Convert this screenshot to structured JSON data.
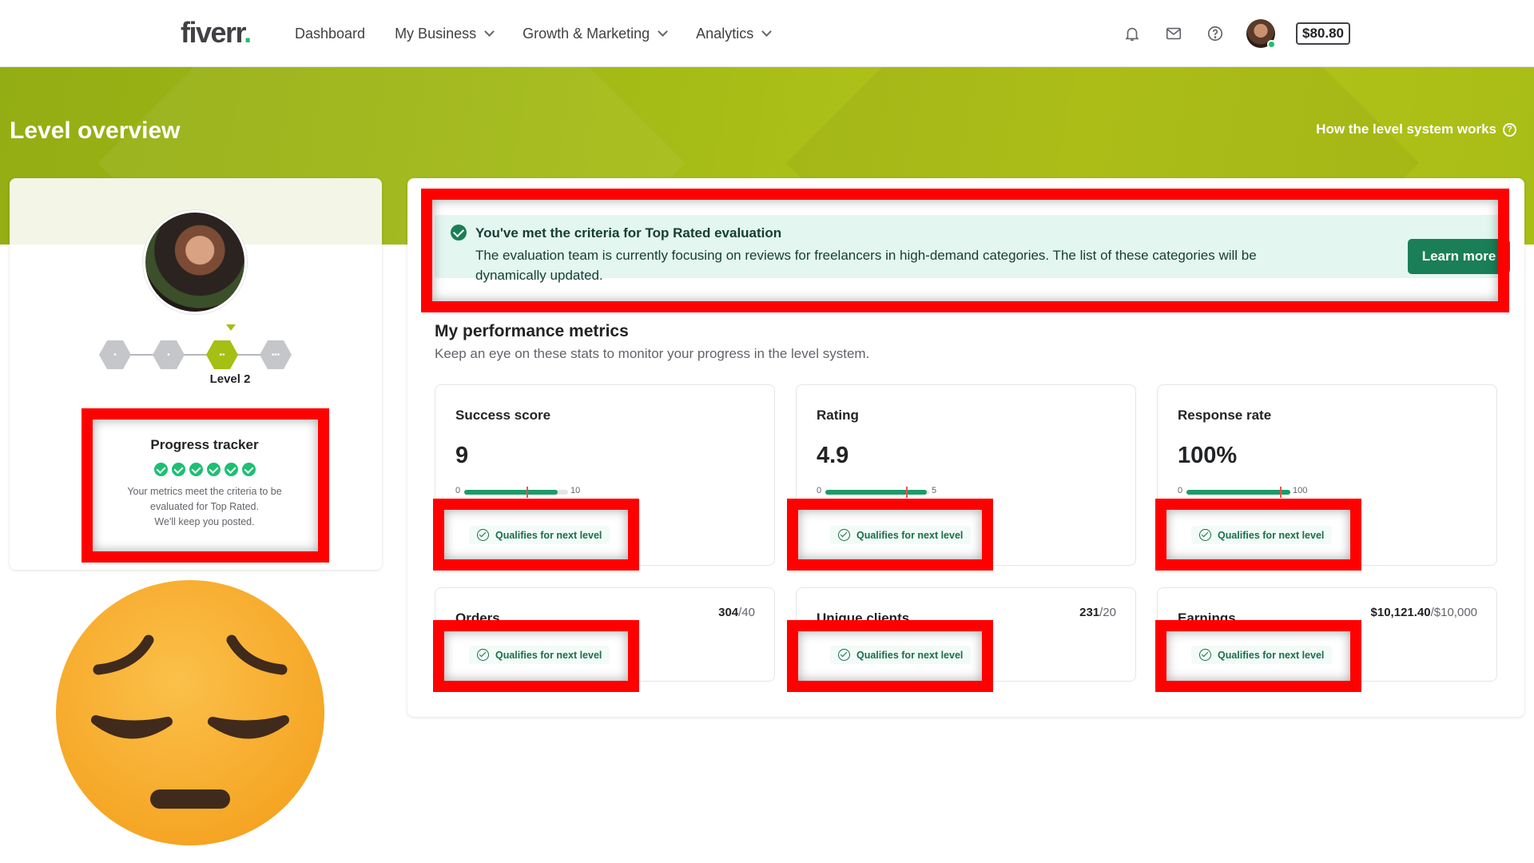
{
  "nav": {
    "logo": "fiverr",
    "logo_dot": ".",
    "items": [
      {
        "label": "Dashboard",
        "has_menu": false
      },
      {
        "label": "My Business",
        "has_menu": true
      },
      {
        "label": "Growth & Marketing",
        "has_menu": true
      },
      {
        "label": "Analytics",
        "has_menu": true
      }
    ],
    "icons": [
      "bell-icon",
      "mail-icon",
      "help-icon"
    ],
    "balance": "$80.80"
  },
  "hero": {
    "title": "Level overview",
    "link": "How the level system works",
    "link_icon": "?"
  },
  "profile": {
    "level_label": "Level 2",
    "current_level_index": 2,
    "levels": 4
  },
  "tracker": {
    "title": "Progress tracker",
    "checks_completed": 6,
    "text_line1": "Your metrics meet the criteria to be",
    "text_line2": "evaluated for Top Rated.",
    "text_line3": "We'll keep you posted."
  },
  "banner": {
    "title": "You've met the criteria for Top Rated evaluation",
    "text": "The evaluation team is currently focusing on reviews for freelancers in high-demand categories. The list of these categories will be dynamically updated.",
    "button": "Learn more"
  },
  "metrics": {
    "title": "My performance metrics",
    "subtitle": "Keep an eye on these stats to monitor your progress in the level system.",
    "qualifies_text": "Qualifies for next level",
    "big": [
      {
        "label": "Success score",
        "value": "9",
        "min": "0",
        "max": "10",
        "fill_ratio": 0.9,
        "threshold_ratio": 0.6
      },
      {
        "label": "Rating",
        "value": "4.9",
        "min": "0",
        "max": "5",
        "fill_ratio": 0.98,
        "threshold_ratio": 0.78
      },
      {
        "label": "Response rate",
        "value": "100%",
        "min": "0",
        "max": "100",
        "fill_ratio": 1.0,
        "threshold_ratio": 0.9
      }
    ],
    "small": [
      {
        "label": "Orders",
        "current": "304",
        "target": "/40"
      },
      {
        "label": "Unique clients",
        "current": "231",
        "target": "/20"
      },
      {
        "label": "Earnings",
        "current": "$10,121.40",
        "target": "/$10,000"
      }
    ]
  },
  "colors": {
    "brand_green": "#1dbf73",
    "hero_green": "#a4bb16",
    "cta_green": "#1a7f56",
    "highlight_red": "#ff0000",
    "emoji_orange": "#f9ae2c"
  }
}
